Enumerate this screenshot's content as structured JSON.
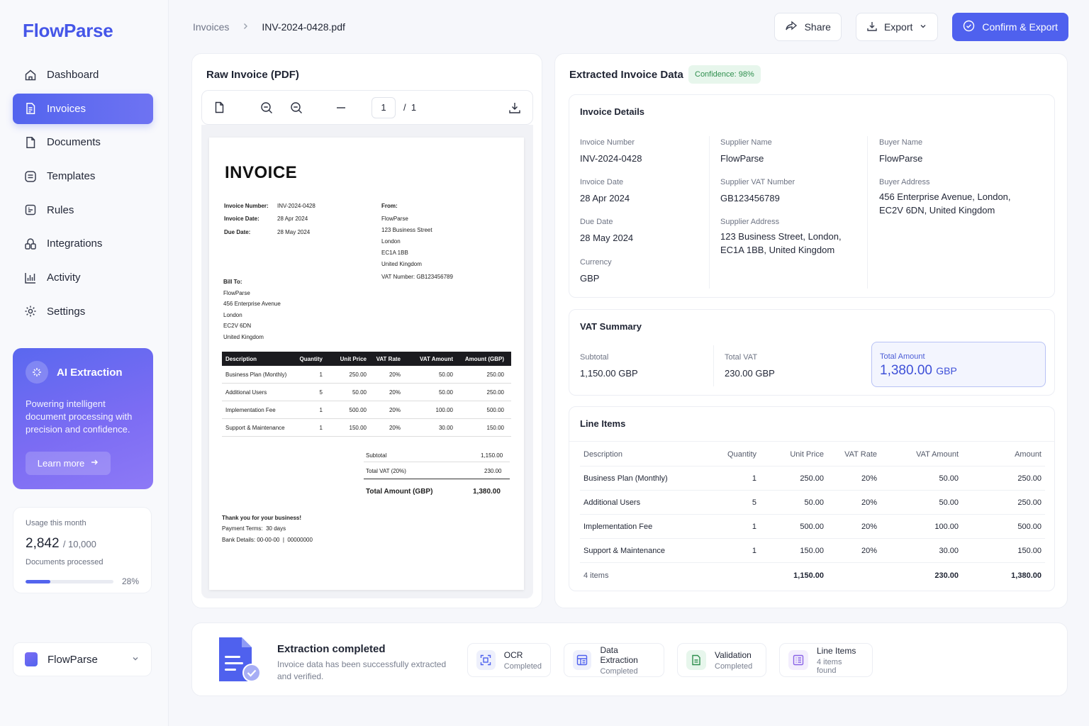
{
  "app": {
    "name": "FlowParse"
  },
  "sidebar": {
    "items": [
      {
        "label": "Dashboard",
        "icon": "home-icon"
      },
      {
        "label": "Invoices",
        "icon": "invoice-icon",
        "active": true
      },
      {
        "label": "Documents",
        "icon": "document-icon"
      },
      {
        "label": "Templates",
        "icon": "templates-icon"
      },
      {
        "label": "Rules",
        "icon": "rules-icon"
      },
      {
        "label": "Integrations",
        "icon": "integrations-icon"
      },
      {
        "label": "Activity",
        "icon": "activity-icon"
      },
      {
        "label": "Settings",
        "icon": "gear-icon"
      }
    ],
    "ai_card": {
      "title": "AI Extraction",
      "description": "Powering intelligent document processing with precision and confidence.",
      "button": "Learn more"
    },
    "usage": {
      "label": "Usage this month",
      "used": "2,842",
      "limit": "/ 10,000",
      "sub": "Documents processed",
      "percent_label": "28%",
      "percent": 0.28
    },
    "workspace": {
      "name": "FlowParse"
    }
  },
  "header": {
    "breadcrumb": {
      "parent": "Invoices",
      "current": "INV-2024-0428.pdf"
    },
    "share_label": "Share",
    "export_label": "Export",
    "confirm_label": "Confirm & Export"
  },
  "pdf_panel": {
    "title": "Raw Invoice (PDF)",
    "page_current": "1",
    "page_total": "/  1",
    "invoice": {
      "heading": "INVOICE",
      "meta": [
        {
          "label": "Invoice Number:",
          "value": "INV-2024-0428"
        },
        {
          "label": "Invoice Date:",
          "value": "28 Apr 2024"
        },
        {
          "label": "Due Date:",
          "value": "28 May 2024"
        }
      ],
      "from_label": "From:",
      "from_lines": [
        "FlowParse",
        "123 Business Street",
        "London",
        "EC1A 1BB",
        "United Kingdom",
        "VAT Number: GB123456789"
      ],
      "bill_to_label": "Bill To:",
      "bill_to_lines": [
        "FlowParse",
        "456 Enterprise Avenue",
        "London",
        "EC2V 6DN",
        "United Kingdom"
      ],
      "columns": [
        "Description",
        "Quantity",
        "Unit Price",
        "VAT Rate",
        "VAT Amount",
        "Amount (GBP)"
      ],
      "rows": [
        [
          "Business Plan (Monthly)",
          "1",
          "250.00",
          "20%",
          "50.00",
          "250.00"
        ],
        [
          "Additional Users",
          "5",
          "50.00",
          "20%",
          "50.00",
          "250.00"
        ],
        [
          "Implementation Fee",
          "1",
          "500.00",
          "20%",
          "100.00",
          "500.00"
        ],
        [
          "Support & Maintenance",
          "1",
          "150.00",
          "20%",
          "30.00",
          "150.00"
        ]
      ],
      "subtotal_label": "Subtotal",
      "subtotal": "1,150.00",
      "vat_label": "Total VAT (20%)",
      "vat": "230.00",
      "total_label": "Total Amount (GBP)",
      "total": "1,380.00",
      "thanks": "Thank you for your business!",
      "terms": "Payment Terms:  30 days",
      "bank": "Bank Details: 00-00-00  |  00000000"
    }
  },
  "data_panel": {
    "title": "Extracted Invoice Data",
    "confidence": "Confidence: 98%",
    "details": {
      "title": "Invoice Details",
      "fields": {
        "invoice_number": {
          "label": "Invoice Number",
          "value": "INV-2024-0428"
        },
        "invoice_date": {
          "label": "Invoice Date",
          "value": "28 Apr 2024"
        },
        "due_date": {
          "label": "Due Date",
          "value": "28 May 2024"
        },
        "currency": {
          "label": "Currency",
          "value": "GBP"
        },
        "supplier_name": {
          "label": "Supplier Name",
          "value": "FlowParse"
        },
        "supplier_vat": {
          "label": "Supplier VAT Number",
          "value": "GB123456789"
        },
        "supplier_address": {
          "label": "Supplier Address",
          "value": "123 Business Street, London, EC1A 1BB, United Kingdom"
        },
        "buyer_name": {
          "label": "Buyer Name",
          "value": "FlowParse"
        },
        "buyer_address": {
          "label": "Buyer Address",
          "value": "456 Enterprise Avenue, London, EC2V 6DN, United Kingdom"
        }
      }
    },
    "vat_summary": {
      "title": "VAT Summary",
      "subtotal_label": "Subtotal",
      "subtotal": "1,150.00 GBP",
      "vat_label": "Total VAT",
      "vat": "230.00 GBP",
      "total_label": "Total Amount",
      "total": "1,380.00",
      "total_currency": "GBP"
    },
    "line_items": {
      "title": "Line Items",
      "columns": [
        "Description",
        "Quantity",
        "Unit Price",
        "VAT Rate",
        "VAT Amount",
        "Amount"
      ],
      "rows": [
        [
          "Business Plan (Monthly)",
          "1",
          "250.00",
          "20%",
          "50.00",
          "250.00"
        ],
        [
          "Additional Users",
          "5",
          "50.00",
          "20%",
          "50.00",
          "250.00"
        ],
        [
          "Implementation Fee",
          "1",
          "500.00",
          "20%",
          "100.00",
          "500.00"
        ],
        [
          "Support & Maintenance",
          "1",
          "150.00",
          "20%",
          "30.00",
          "150.00"
        ]
      ],
      "footer": {
        "count": "4 items",
        "unit_total": "1,150.00",
        "vat_total": "230.00",
        "amount_total": "1,380.00"
      }
    }
  },
  "status": {
    "title": "Extraction completed",
    "description": "Invoice data has been successfully extracted and verified.",
    "steps": [
      {
        "title": "OCR",
        "status": "Completed",
        "icon": "ocr-icon"
      },
      {
        "title": "Data Extraction",
        "status": "Completed",
        "icon": "data-extraction-icon"
      },
      {
        "title": "Validation",
        "status": "Completed",
        "icon": "validation-icon"
      },
      {
        "title": "Line Items",
        "status": "4 items found",
        "icon": "list-icon"
      }
    ]
  },
  "colors": {
    "accent": "#4f61ee",
    "success": "#2f8f4e"
  }
}
